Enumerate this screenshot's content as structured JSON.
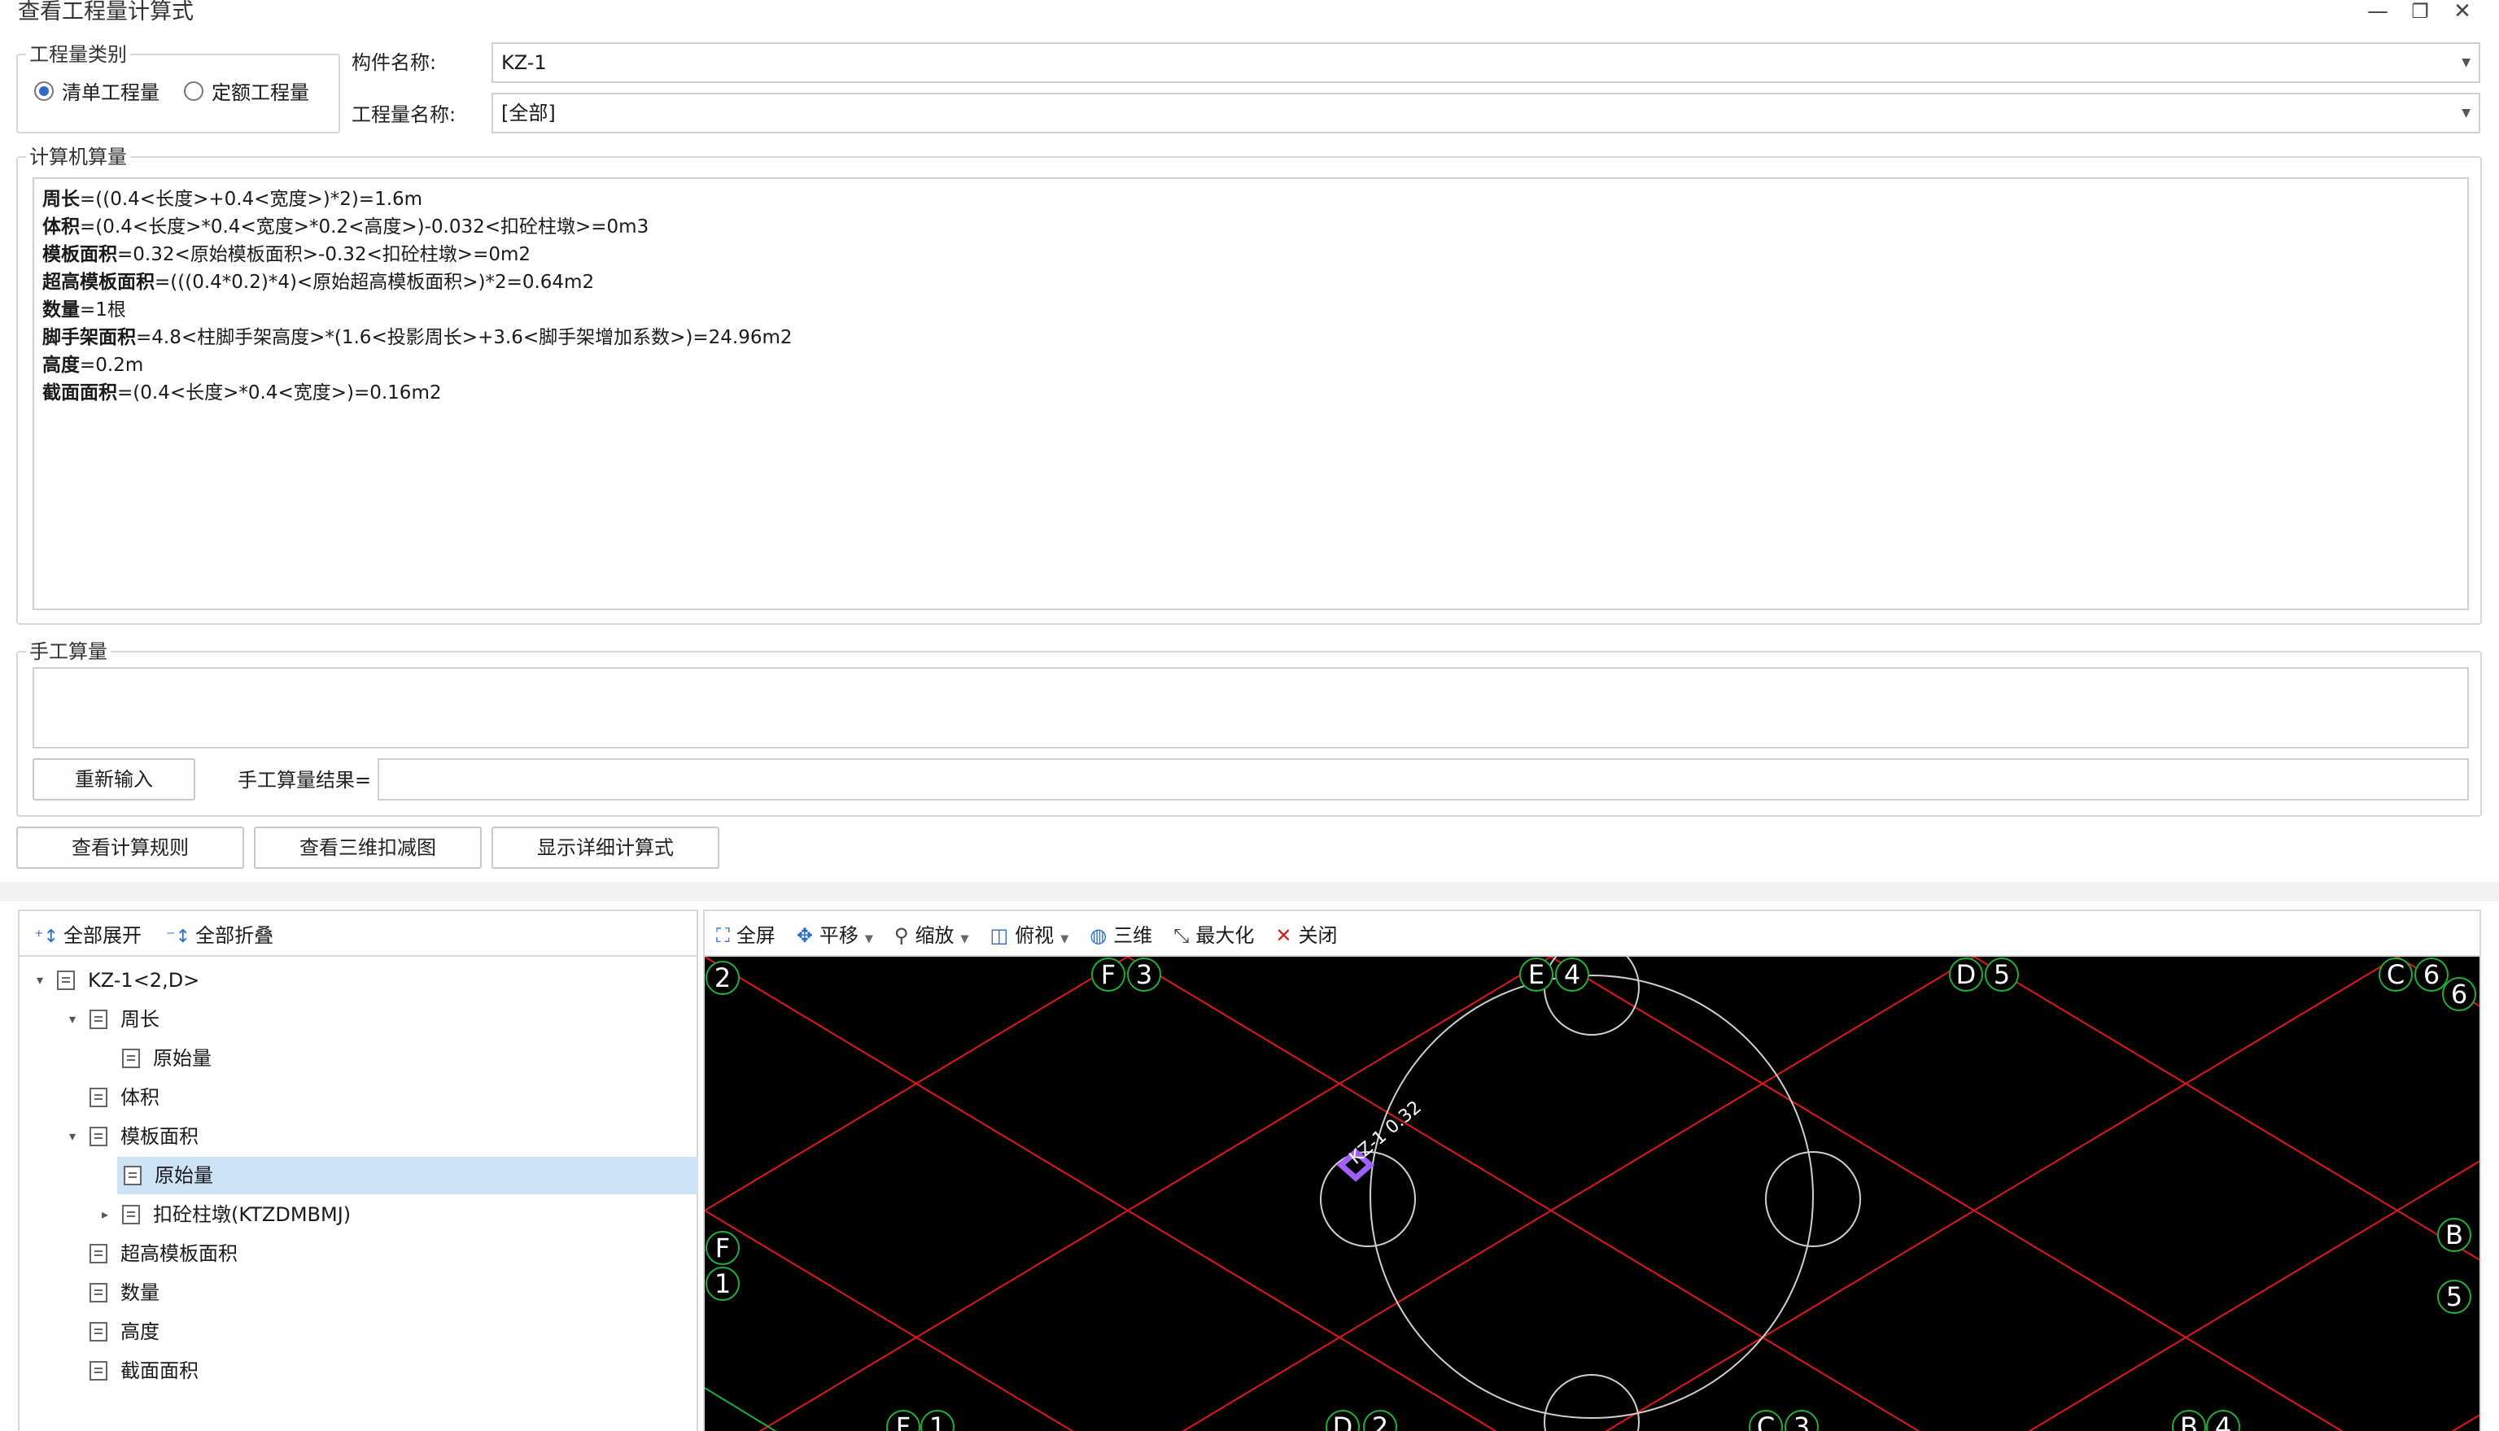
{
  "window": {
    "title": "查看工程量计算式",
    "min_icon": "minimize-icon",
    "restore_icon": "restore-icon",
    "close_icon": "close-icon"
  },
  "quantity_type": {
    "legend": "工程量类别",
    "options": [
      "清单工程量",
      "定额工程量"
    ],
    "selected": "清单工程量"
  },
  "component": {
    "label": "构件名称:",
    "value": "KZ-1"
  },
  "quantity_name": {
    "label": "工程量名称:",
    "value": "[全部]"
  },
  "computer_calc": {
    "legend": "计算机算量",
    "lines": [
      {
        "name": "周长",
        "expr": "=((0.4<长度>+0.4<宽度>)*2)=1.6m"
      },
      {
        "name": "体积",
        "expr": "=(0.4<长度>*0.4<宽度>*0.2<高度>)-0.032<扣砼柱墩>=0m3"
      },
      {
        "name": "模板面积",
        "expr": "=0.32<原始模板面积>-0.32<扣砼柱墩>=0m2"
      },
      {
        "name": "超高模板面积",
        "expr": "=(((0.4*0.2)*4)<原始超高模板面积>)*2=0.64m2"
      },
      {
        "name": "数量",
        "expr": "=1根"
      },
      {
        "name": "脚手架面积",
        "expr": "=4.8<柱脚手架高度>*(1.6<投影周长>+3.6<脚手架增加系数>)=24.96m2"
      },
      {
        "name": "高度",
        "expr": "=0.2m"
      },
      {
        "name": "截面面积",
        "expr": "=(0.4<长度>*0.4<宽度>)=0.16m2"
      }
    ]
  },
  "manual_calc": {
    "legend": "手工算量",
    "reenter_button": "重新输入",
    "result_label": "手工算量结果="
  },
  "actions": {
    "view_rules": "查看计算规则",
    "view_3d": "查看三维扣减图",
    "show_detail": "显示详细计算式"
  },
  "tree_toolbar": {
    "expand_all": "全部展开",
    "collapse_all": "全部折叠"
  },
  "tree": [
    {
      "label": "KZ-1<2,D>",
      "level": 0,
      "toggle": "open"
    },
    {
      "label": "周长",
      "level": 1,
      "toggle": "open"
    },
    {
      "label": "原始量",
      "level": 2,
      "toggle": "none"
    },
    {
      "label": "体积",
      "level": 1,
      "toggle": "none"
    },
    {
      "label": "模板面积",
      "level": 1,
      "toggle": "open"
    },
    {
      "label": "原始量",
      "level": 2,
      "toggle": "none",
      "selected": true
    },
    {
      "label": "扣砼柱墩(KTZDMBMJ)",
      "level": 2,
      "toggle": "closed"
    },
    {
      "label": "超高模板面积",
      "level": 1,
      "toggle": "none"
    },
    {
      "label": "数量",
      "level": 1,
      "toggle": "none"
    },
    {
      "label": "高度",
      "level": 1,
      "toggle": "none"
    },
    {
      "label": "截面面积",
      "level": 1,
      "toggle": "none"
    }
  ],
  "view_toolbar": {
    "fullscreen": "全屏",
    "pan": "平移",
    "zoom": "缩放",
    "top_view": "俯视",
    "three_d": "三维",
    "maximize": "最大化",
    "close": "关闭"
  },
  "canvas": {
    "component_label": "KZ-1 0.32",
    "axis_labels_top": [
      "2",
      "F",
      "3",
      "E",
      "4",
      "D",
      "5",
      "C",
      "6",
      "6"
    ],
    "axis_labels_left": [
      "F",
      "1"
    ],
    "axis_labels_right": [
      "B",
      "5"
    ],
    "axis_labels_bottom": [
      "F",
      "1",
      "D",
      "2",
      "C",
      "3",
      "B",
      "4"
    ],
    "colors": {
      "background": "#000000",
      "grid_line": "#e01818",
      "circle": "#cfcfcf",
      "axis_marker": "#1fae3a",
      "component": "#a060ff"
    }
  }
}
